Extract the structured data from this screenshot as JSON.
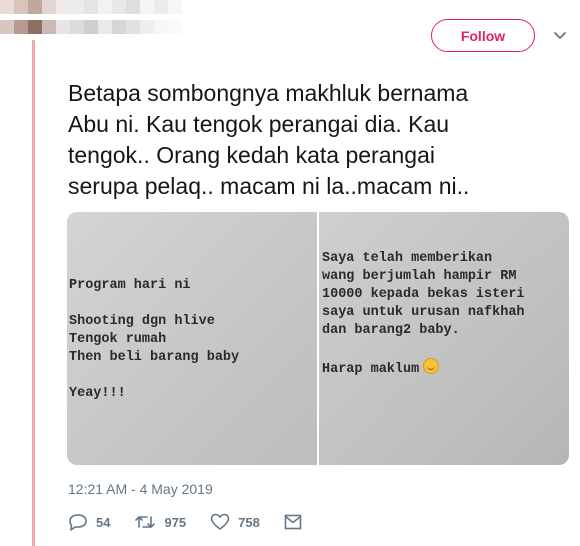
{
  "header": {
    "follow_label": "Follow",
    "follow_color": "#e0245e",
    "menu_icon": "chevron-down-icon"
  },
  "tweet": {
    "text": "Betapa sombongnya makhluk bernama\nAbu ni. Kau tengok perangai dia. Kau\ntengok.. Orang kedah kata perangai\nserupa pelaq.. macam ni la..macam ni..",
    "timestamp": "12:21 AM - 4 May 2019",
    "thread_line_color": "#f4a9a9"
  },
  "media": {
    "left_text": "Program hari ni\n\nShooting dgn hlive\nTengok rumah\nThen beli barang baby\n\nYeay!!!",
    "right_text": "Saya telah memberikan\nwang berjumlah hampir RM\n10000 kepada bekas isteri\nsaya untuk urusan nafkhah\ndan barang2 baby.\n\nHarap maklum",
    "right_emoji_icon": "smile-emoji-icon"
  },
  "actions": {
    "replies": "54",
    "retweets": "975",
    "likes": "758",
    "icons": [
      "reply-icon",
      "retweet-icon",
      "like-icon",
      "message-icon"
    ]
  }
}
